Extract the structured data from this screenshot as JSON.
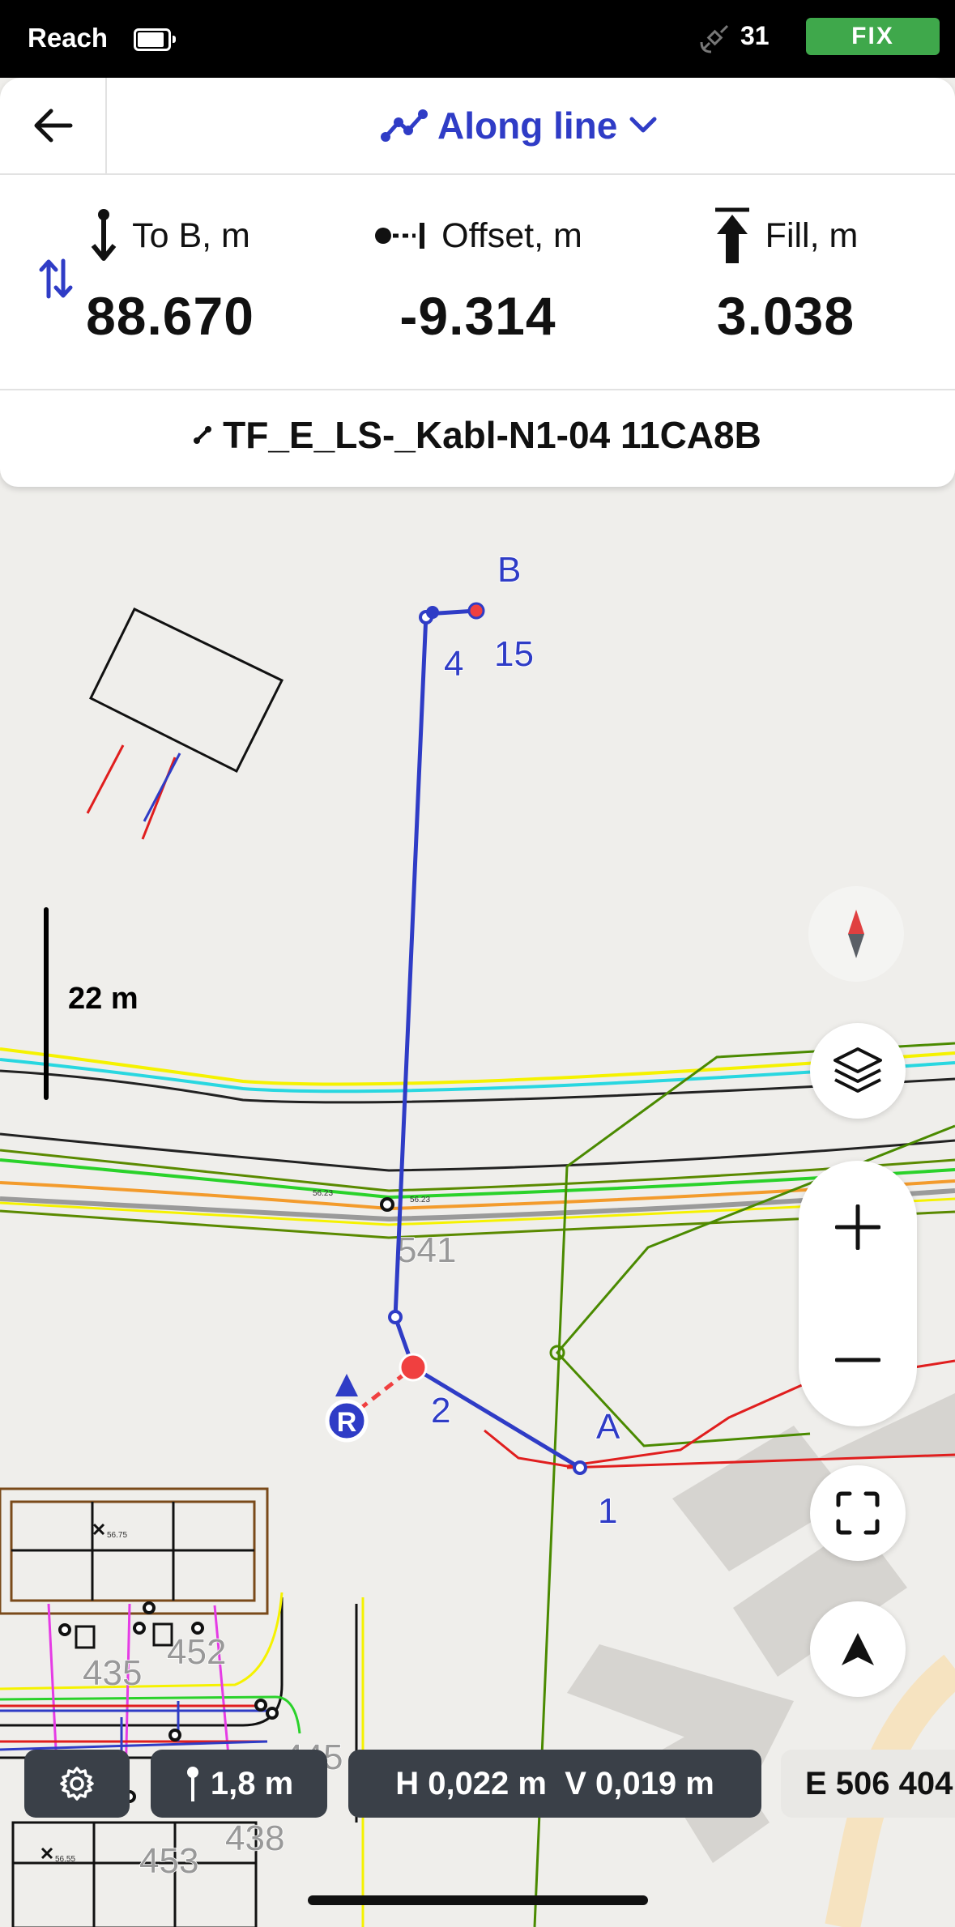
{
  "status_bar": {
    "app_name": "Reach",
    "battery_level": 0.8,
    "satellites": "31",
    "fix_status": "FIX"
  },
  "header": {
    "mode_label": "Along line",
    "mode_icon": "polyline-icon"
  },
  "metrics": [
    {
      "label": "To B, m",
      "value": "88.670",
      "icon": "arrow-down-to-point-icon"
    },
    {
      "label": "Offset, m",
      "value": "-9.314",
      "icon": "offset-icon"
    },
    {
      "label": "Fill, m",
      "value": "3.038",
      "icon": "arrow-up-fill-icon"
    }
  ],
  "line_name": "TF_E_LS-_Kabl-N1-04 11CA8B",
  "map": {
    "scale_label": "22 m",
    "point_labels": {
      "B": "B",
      "A": "A",
      "p4": "4",
      "p15": "15",
      "p2": "2",
      "p1": "1",
      "rover": "R"
    },
    "parcel_labels": [
      "541",
      "435",
      "452",
      "445",
      "438",
      "453"
    ],
    "elevations": [
      "56.23",
      "56.23",
      "56.75",
      "56.55"
    ],
    "colors": {
      "track": "#2f3cc6",
      "target": "#f04040",
      "cable": "#e01e1e"
    }
  },
  "bottom_bar": {
    "antenna_height": "1,8 m",
    "accuracy": "H 0,022 m  V 0,019 m",
    "easting": "E 506 404"
  }
}
